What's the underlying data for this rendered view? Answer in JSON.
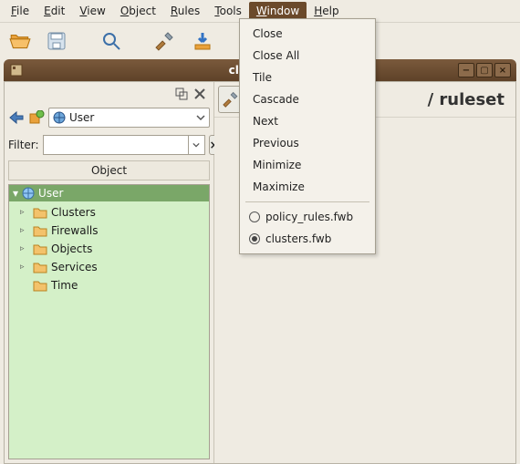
{
  "menubar": {
    "file": "File",
    "edit": "Edit",
    "view": "View",
    "object": "Object",
    "rules": "Rules",
    "tools": "Tools",
    "window": "Window",
    "help": "Help"
  },
  "window_title": "clust",
  "left": {
    "combo_label": "User",
    "filter_label": "Filter:",
    "object_header": "Object",
    "tree_root": "User",
    "tree_items": [
      {
        "label": "Clusters",
        "expandable": true
      },
      {
        "label": "Firewalls",
        "expandable": true
      },
      {
        "label": "Objects",
        "expandable": true
      },
      {
        "label": "Services",
        "expandable": true
      },
      {
        "label": "Time",
        "expandable": false
      }
    ]
  },
  "right": {
    "heading": "/ ruleset"
  },
  "dropdown": {
    "close": "Close",
    "close_all": "Close All",
    "tile": "Tile",
    "cascade": "Cascade",
    "next": "Next",
    "previous": "Previous",
    "minimize": "Minimize",
    "maximize": "Maximize",
    "radio_policy": "policy_rules.fwb",
    "radio_clusters": "clusters.fwb"
  }
}
